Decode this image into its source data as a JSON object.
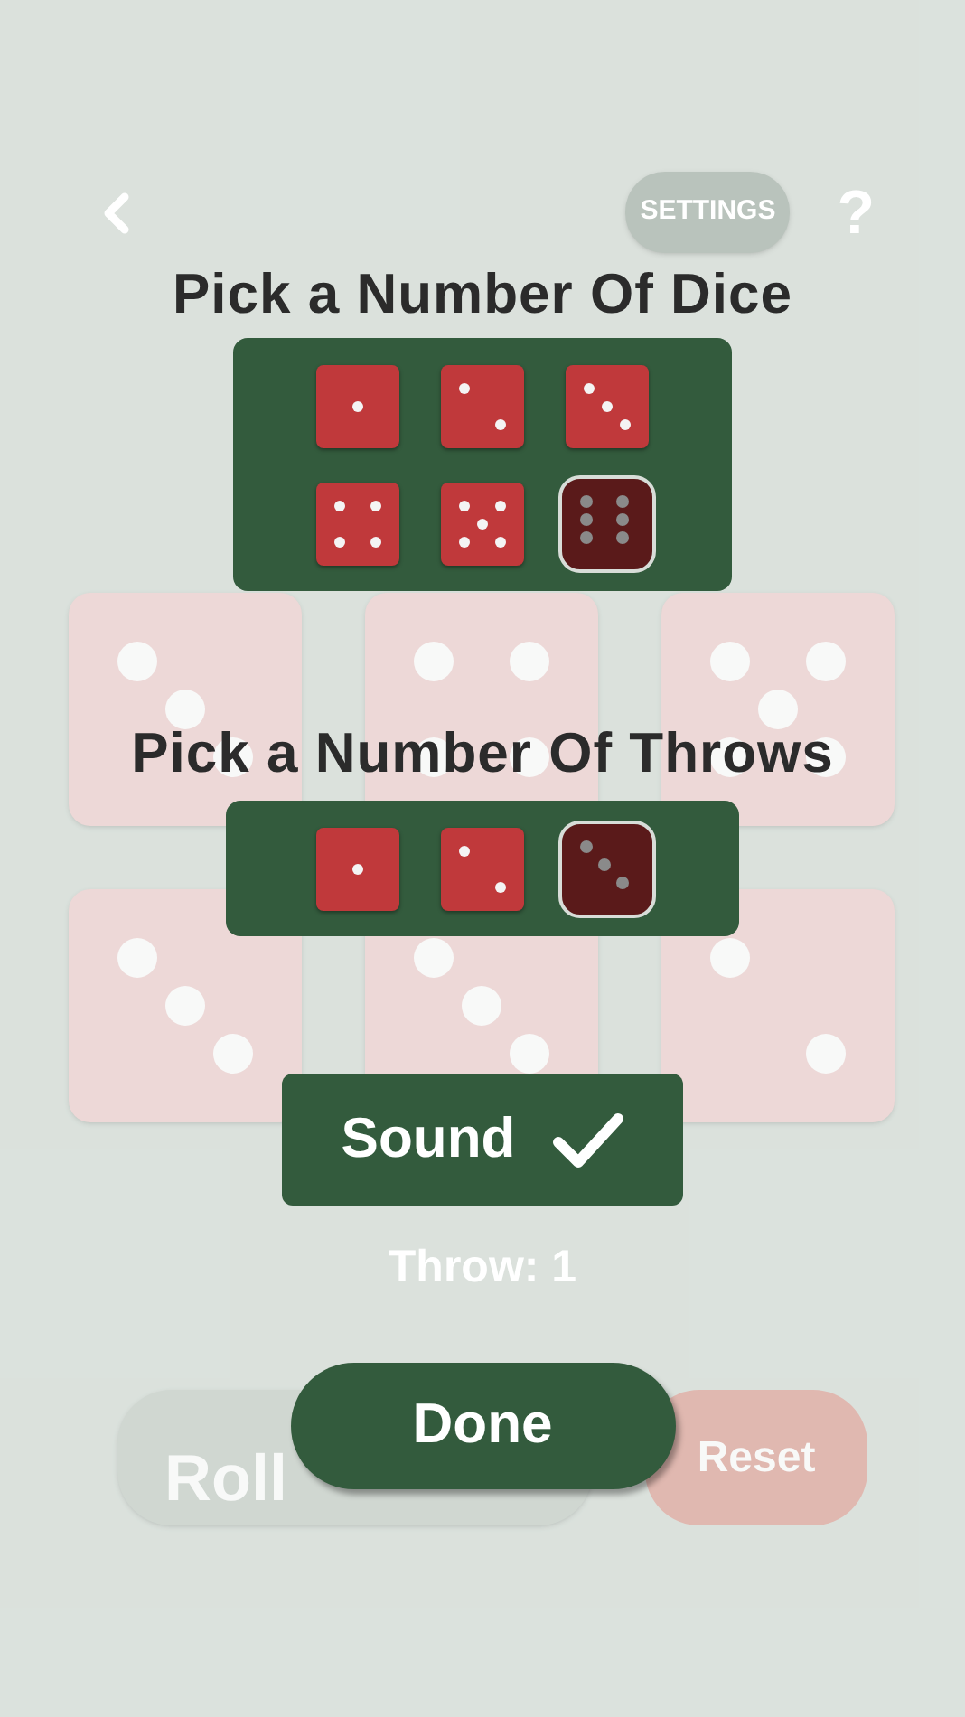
{
  "background": {
    "dice": [
      {
        "kind": "three"
      },
      {
        "kind": "four"
      },
      {
        "kind": "five"
      },
      {
        "kind": "three"
      },
      {
        "kind": "three"
      },
      {
        "kind": "two"
      }
    ],
    "roll_button": "Roll",
    "reset_button": "Reset"
  },
  "header": {
    "settings_button": "SETTINGS",
    "help_button": "?"
  },
  "dice_picker": {
    "title": "Pick a Number Of Dice",
    "options": [
      {
        "kind": "one",
        "selected": false
      },
      {
        "kind": "two",
        "selected": false
      },
      {
        "kind": "three",
        "selected": false
      },
      {
        "kind": "four",
        "selected": false
      },
      {
        "kind": "five",
        "selected": false
      },
      {
        "kind": "six",
        "selected": true
      }
    ]
  },
  "throws_picker": {
    "title": "Pick a Number Of Throws",
    "options": [
      {
        "kind": "one",
        "selected": false
      },
      {
        "kind": "two",
        "selected": false
      },
      {
        "kind": "three",
        "selected": true
      }
    ]
  },
  "sound_toggle": {
    "label": "Sound",
    "checked": true
  },
  "throw_counter": "Throw: 1",
  "done_button": "Done"
}
